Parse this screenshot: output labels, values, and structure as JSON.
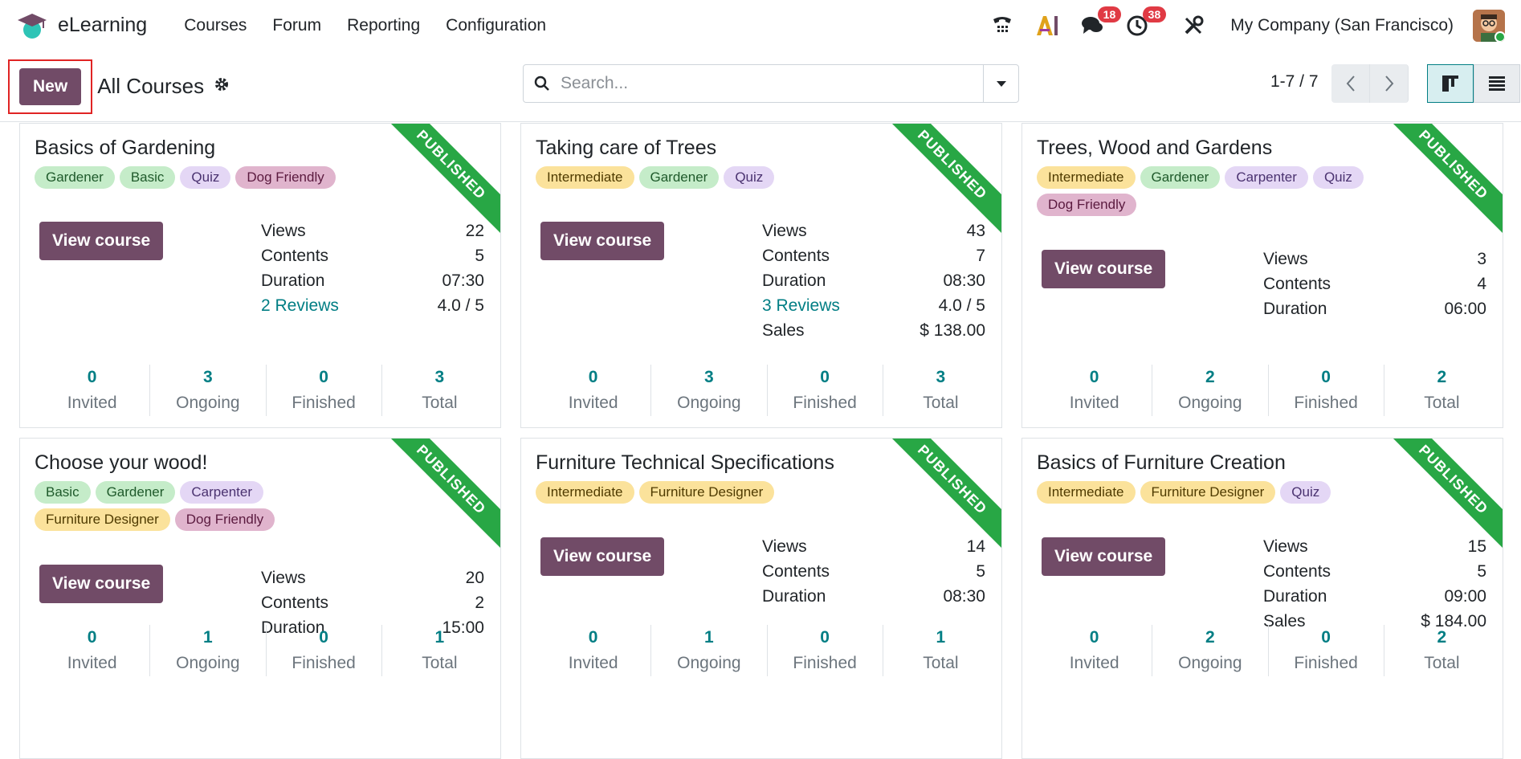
{
  "app": {
    "name": "eLearning",
    "menu": [
      "Courses",
      "Forum",
      "Reporting",
      "Configuration"
    ],
    "messages_count": "18",
    "activities_count": "38",
    "company": "My Company (San Francisco)"
  },
  "control": {
    "new_label": "New",
    "title": "All Courses",
    "search_placeholder": "Search...",
    "pager": "1-7 / 7"
  },
  "labels": {
    "published": "PUBLISHED",
    "view_course": "View course",
    "views": "Views",
    "contents": "Contents",
    "duration": "Duration",
    "sales": "Sales",
    "invited": "Invited",
    "ongoing": "Ongoing",
    "finished": "Finished",
    "total": "Total"
  },
  "courses": [
    {
      "title": "Basics of Gardening",
      "tags": [
        [
          "Gardener",
          "green"
        ],
        [
          "Basic",
          "green"
        ],
        [
          "Quiz",
          "purple"
        ],
        [
          "Dog Friendly",
          "pink"
        ]
      ],
      "views": "22",
      "contents": "5",
      "duration": "07:30",
      "reviews": "2 Reviews",
      "rating": "4.0 / 5",
      "sales": "",
      "invited": "0",
      "ongoing": "3",
      "finished": "0",
      "total": "3"
    },
    {
      "title": "Taking care of Trees",
      "tags": [
        [
          "Intermediate",
          "yellow"
        ],
        [
          "Gardener",
          "green"
        ],
        [
          "Quiz",
          "purple"
        ]
      ],
      "views": "43",
      "contents": "7",
      "duration": "08:30",
      "reviews": "3 Reviews",
      "rating": "4.0 / 5",
      "sales": "$ 138.00",
      "invited": "0",
      "ongoing": "3",
      "finished": "0",
      "total": "3"
    },
    {
      "title": "Trees, Wood and Gardens",
      "tags": [
        [
          "Intermediate",
          "yellow"
        ],
        [
          "Gardener",
          "green"
        ],
        [
          "Carpenter",
          "purple"
        ],
        [
          "Quiz",
          "purple"
        ],
        [
          "Dog Friendly",
          "pink"
        ]
      ],
      "views": "3",
      "contents": "4",
      "duration": "06:00",
      "reviews": "",
      "rating": "",
      "sales": "",
      "invited": "0",
      "ongoing": "2",
      "finished": "0",
      "total": "2"
    },
    {
      "title": "Choose your wood!",
      "tags": [
        [
          "Basic",
          "green"
        ],
        [
          "Gardener",
          "green"
        ],
        [
          "Carpenter",
          "purple"
        ],
        [
          "Furniture Designer",
          "yellow"
        ],
        [
          "Dog Friendly",
          "pink"
        ]
      ],
      "views": "20",
      "contents": "2",
      "duration": "15:00",
      "reviews": "",
      "rating": "",
      "sales": "",
      "invited": "0",
      "ongoing": "1",
      "finished": "0",
      "total": "1"
    },
    {
      "title": "Furniture Technical Specifications",
      "tags": [
        [
          "Intermediate",
          "yellow"
        ],
        [
          "Furniture Designer",
          "yellow"
        ]
      ],
      "views": "14",
      "contents": "5",
      "duration": "08:30",
      "reviews": "",
      "rating": "",
      "sales": "",
      "invited": "0",
      "ongoing": "1",
      "finished": "0",
      "total": "1"
    },
    {
      "title": "Basics of Furniture Creation",
      "tags": [
        [
          "Intermediate",
          "yellow"
        ],
        [
          "Furniture Designer",
          "yellow"
        ],
        [
          "Quiz",
          "purple"
        ]
      ],
      "views": "15",
      "contents": "5",
      "duration": "09:00",
      "reviews": "",
      "rating": "",
      "sales": "$ 184.00",
      "invited": "0",
      "ongoing": "2",
      "finished": "0",
      "total": "2"
    }
  ]
}
